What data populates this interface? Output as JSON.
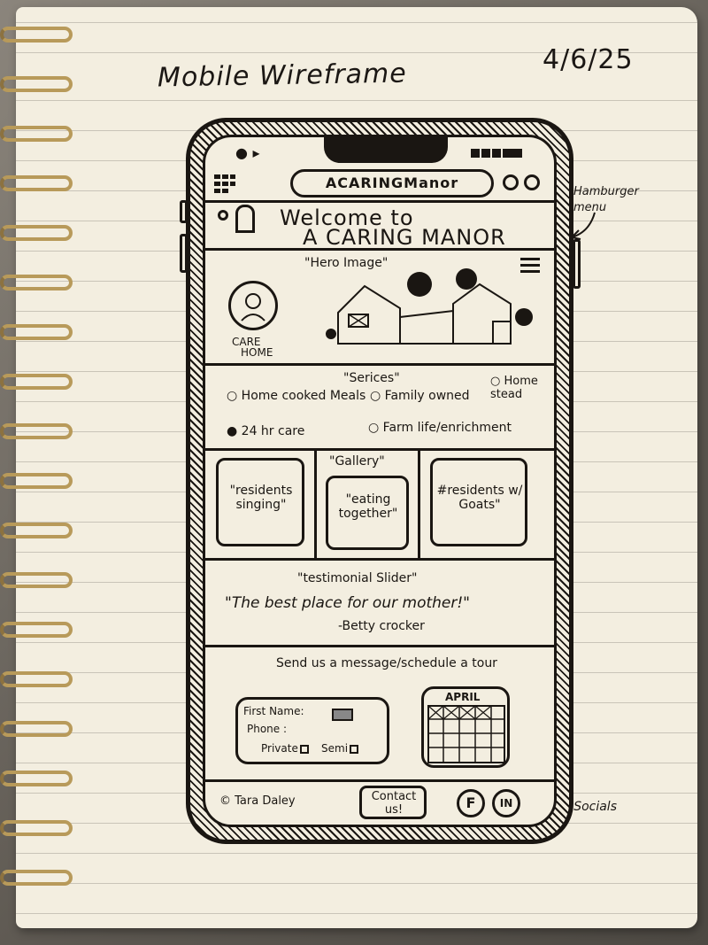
{
  "notebook": {
    "title": "Mobile Wireframe",
    "date": "4/6/25",
    "annotation_hamburger": "Hamburger menu",
    "annotation_socials": "Socials"
  },
  "header": {
    "brand": "ACARINGManor",
    "welcome_line1": "Welcome to",
    "welcome_line2": "A CARING MANOR"
  },
  "hero": {
    "label": "\"Hero Image\"",
    "logo_caption_line1": "CARE",
    "logo_caption_line2": "HOME"
  },
  "services": {
    "heading": "\"Serices\"",
    "items": [
      "Home cooked Meals",
      "Family owned",
      "Home stead",
      "24 hr care",
      "Farm life/enrichment"
    ]
  },
  "gallery": {
    "heading": "\"Gallery\"",
    "cards": [
      "\"residents singing\"",
      "\"eating together\"",
      "#residents w/ Goats\""
    ]
  },
  "testimonial": {
    "heading": "\"testimonial Slider\"",
    "quote": "\"The best place for our mother!\"",
    "author": "-Betty crocker"
  },
  "contact": {
    "heading": "Send us a message/schedule a tour",
    "first_name_label": "First Name:",
    "phone_label": "Phone :",
    "private_label": "Private",
    "semi_label": "Semi",
    "calendar_month": "APRIL"
  },
  "footer": {
    "copyright": "Tara Daley",
    "contact_button": "Contact us!",
    "social_1": "F",
    "social_2": "IN"
  }
}
